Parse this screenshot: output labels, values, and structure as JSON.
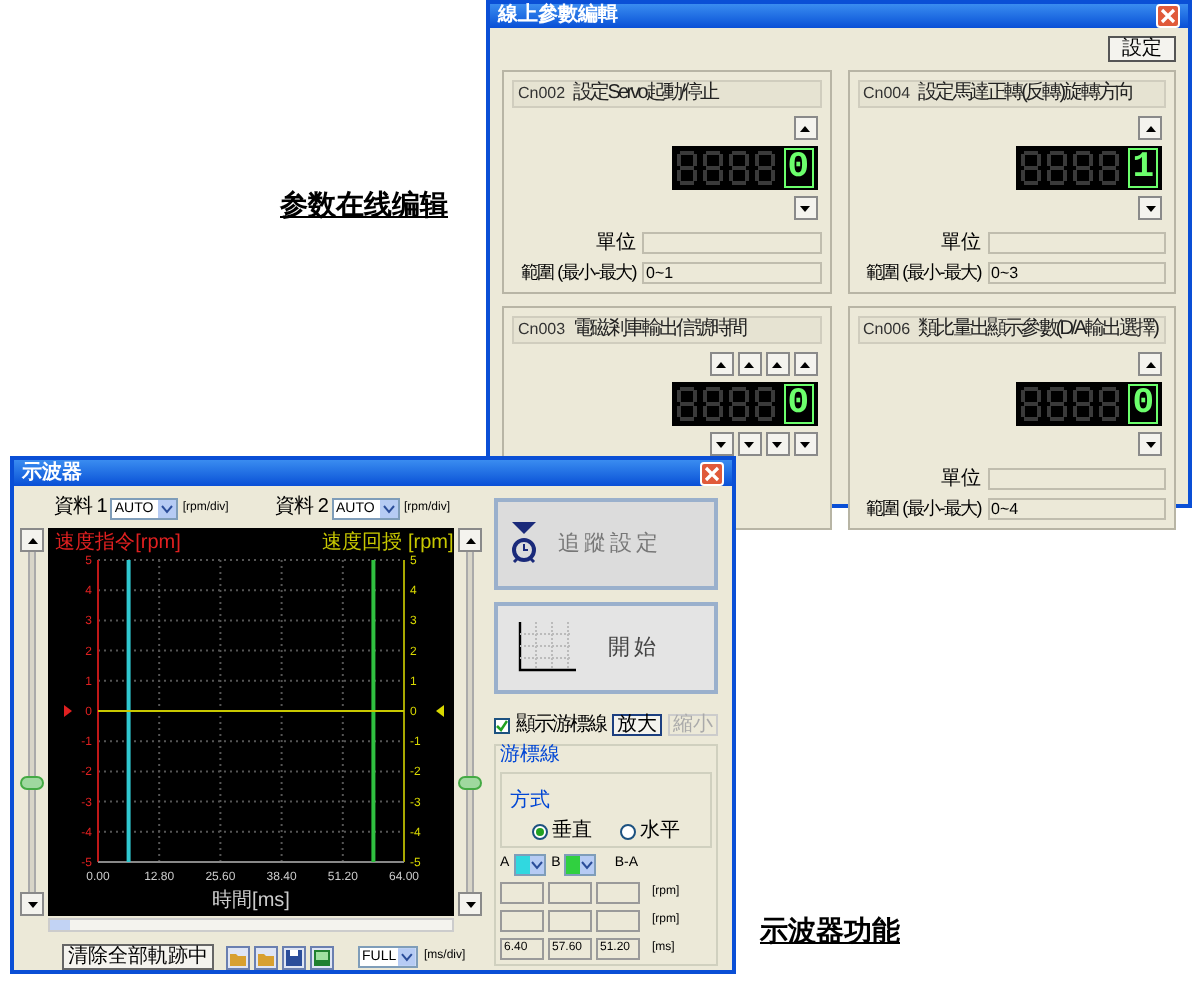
{
  "parameter_editor": {
    "caption": "参数在线编辑",
    "title": "線上參數編輯",
    "set_button": "設定",
    "panels": [
      {
        "code": "Cn002",
        "name": "設定Servo起動/停止",
        "kind": "single",
        "value": "0",
        "unit_label": "單位",
        "range_label": "範圍 (最小-最大)",
        "range": "0~1"
      },
      {
        "code": "Cn004",
        "name": "設定馬達正轉(反轉)旋轉方向",
        "kind": "single",
        "value": "1",
        "unit_label": "單位",
        "range_label": "範圍 (最小-最大)",
        "range": "0~3"
      },
      {
        "code": "Cn003",
        "name": "電磁剎車輸出信號時間",
        "kind": "multi",
        "value": "0"
      },
      {
        "code": "Cn006",
        "name": "類比量出顯示參數(D/A輸出選擇)",
        "kind": "single",
        "value": "0",
        "unit_label": "單位",
        "range_label": "範圍 (最小-最大)",
        "range": "0~4"
      }
    ]
  },
  "oscilloscope": {
    "caption": "示波器功能",
    "title": "示波器",
    "channels": [
      {
        "label": "資料 1",
        "value": "AUTO",
        "unit": "[rpm/div]"
      },
      {
        "label": "資料 2",
        "value": "AUTO",
        "unit": "[rpm/div]"
      }
    ],
    "chart_data": {
      "type": "line",
      "xlabel": "時間[ms]",
      "ylabel": "速度指令[rpm]",
      "grid": true,
      "xlim": [
        0,
        64
      ],
      "ylim": [
        -5,
        5
      ],
      "xticks": [
        {
          "value": 0,
          "label": "0.00"
        },
        {
          "value": 12.8,
          "label": "12.80"
        },
        {
          "value": 25.6,
          "label": "25.60"
        },
        {
          "value": 38.4,
          "label": "38.40"
        },
        {
          "value": 51.2,
          "label": "51.20"
        },
        {
          "value": 64,
          "label": "64.00"
        }
      ],
      "yticks": [
        5,
        4,
        3,
        2,
        1,
        0,
        -1,
        -2,
        -3,
        -4,
        -5
      ],
      "y2ticks": [
        5,
        4,
        3,
        2,
        1,
        0,
        -1,
        -2,
        -3,
        -4,
        -5
      ],
      "y2lim": [
        -5,
        5
      ],
      "x": [
        0,
        64
      ],
      "series": [
        {
          "name": "速度回授 [rpm]",
          "color": "#c8c800",
          "values": [
            0,
            0
          ]
        }
      ],
      "ref_lines": [
        {
          "axis": "x",
          "value": 6.4,
          "color": "#30c8d0"
        },
        {
          "axis": "x",
          "value": 57.6,
          "color": "#30c040"
        }
      ]
    },
    "clear_button": "清除全部軌跡中",
    "time_scale": {
      "value": "FULL",
      "unit": "[ms/div]"
    },
    "trace_button": "追蹤設定",
    "start_button": "開始",
    "show_cursor": {
      "label": "顯示游標線",
      "checked": true
    },
    "zoom_in": {
      "label": "放大",
      "disabled": false
    },
    "zoom_out": {
      "label": "縮小",
      "disabled": true
    },
    "cursor_group": {
      "title": "游標線",
      "mode_title": "方式",
      "modes": [
        {
          "label": "垂直",
          "selected": true
        },
        {
          "label": "水平",
          "selected": false
        }
      ],
      "cursors": [
        {
          "label": "A",
          "color": "#30d8e0"
        },
        {
          "label": "B",
          "color": "#30d040"
        }
      ],
      "diff_label": "B-A",
      "rows": [
        {
          "unit": "[rpm]"
        },
        {
          "unit": "[rpm]"
        },
        {
          "values": [
            "6.40",
            "57.60",
            "51.20"
          ],
          "unit": "[ms]"
        }
      ]
    }
  }
}
